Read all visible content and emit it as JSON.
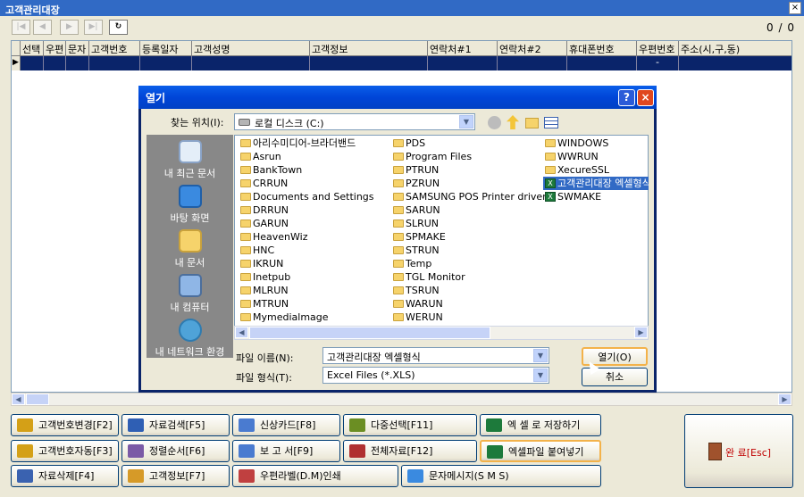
{
  "window": {
    "title": "고객관리대장",
    "close": "×",
    "pager": "0 / 0"
  },
  "toolbar": {
    "first": "|◀",
    "prev": "◀",
    "next": "▶",
    "last": "▶|",
    "refresh": "↻"
  },
  "grid": {
    "columns": [
      "선택",
      "우편",
      "문자",
      "고객번호",
      "등록일자",
      "고객성명",
      "고객정보",
      "연락처#1",
      "연락처#2",
      "휴대폰번호",
      "우편번호",
      "주소(시,구,동)"
    ],
    "row_postal": "-"
  },
  "dialog": {
    "title": "열기",
    "help": "?",
    "close": "×",
    "look_in_label": "찾는 위치(I):",
    "look_in_value": "로컬 디스크 (C:)",
    "places": [
      "내 최근 문서",
      "바탕 화면",
      "내 문서",
      "내 컴퓨터",
      "내 네트워크 환경"
    ],
    "files_col1": [
      "아리수미디어-브라더밴드",
      "Asrun",
      "BankTown",
      "CRRUN",
      "Documents and Settings",
      "DRRUN",
      "GARUN",
      "HeavenWiz",
      "HNC",
      "IKRUN",
      "Inetpub",
      "MLRUN",
      "MTRUN",
      "Mymedialmage"
    ],
    "files_col2": [
      "PDS",
      "Program Files",
      "PTRUN",
      "PZRUN",
      "SAMSUNG POS Printer driver",
      "SARUN",
      "SLRUN",
      "SPMAKE",
      "STRUN",
      "Temp",
      "TGL Monitor",
      "TSRUN",
      "WARUN",
      "WERUN"
    ],
    "files_col3": [
      "WINDOWS",
      "WWRUN",
      "XecureSSL",
      "고객관리대장 엑셀형식",
      "SWMAKE"
    ],
    "filename_label": "파일 이름(N):",
    "filename_value": "고객관리대장 엑셀형식",
    "filetype_label": "파일 형식(T):",
    "filetype_value": "Excel Files (*.XLS)",
    "open_button": "열기(O)",
    "cancel_button": "취소"
  },
  "buttons": {
    "row1": [
      "고객번호변경[F2]",
      "자료검색[F5]",
      "신상카드[F8]",
      "다중선택[F11]",
      "엑 셀 로 저장하기"
    ],
    "row2": [
      "고객번호자동[F3]",
      "정렬순서[F6]",
      "보 고 서[F9]",
      "전체자료[F12]",
      "엑셀파일 붙여넣기"
    ],
    "row3": [
      "자료삭제[F4]",
      "고객정보[F7]",
      "우편라벨(D.M)인쇄",
      "문자메시지(S M S)"
    ],
    "done": "완 료[Esc]"
  }
}
